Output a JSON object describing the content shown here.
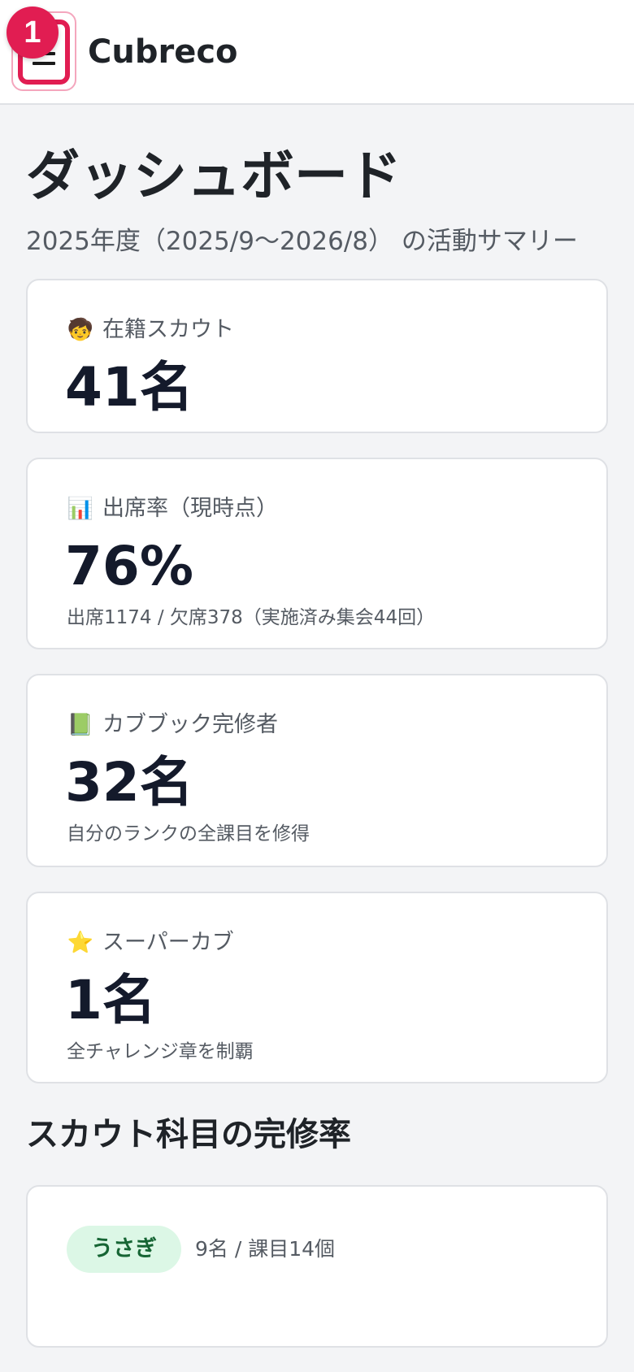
{
  "header": {
    "app_title": "Cubreco",
    "step_badge": "1",
    "menu_icon": "hamburger-menu-icon"
  },
  "page": {
    "title": "ダッシュボード",
    "subtitle": "2025年度（2025/9〜2026/8） の活動サマリー"
  },
  "stats": [
    {
      "icon": "person-icon",
      "emoji": "🧒",
      "label": "在籍スカウト",
      "value": "41名",
      "note": ""
    },
    {
      "icon": "bar-chart-icon",
      "emoji": "📊",
      "label": "出席率（現時点）",
      "value": "76%",
      "note": "出席1174 / 欠席378（実施済み集会44回）"
    },
    {
      "icon": "green-book-icon",
      "emoji": "📗",
      "label": "カブブック完修者",
      "value": "32名",
      "note": "自分のランクの全課目を修得"
    },
    {
      "icon": "star-icon",
      "emoji": "⭐",
      "label": "スーパーカブ",
      "value": "1名",
      "note": "全チャレンジ章を制覇"
    }
  ],
  "completion_section": {
    "title": "スカウト科目の完修率",
    "ranks": [
      {
        "name": "うさぎ",
        "meta": "9名 / 課目14個",
        "pill_bg": "#dcf7e6",
        "pill_fg": "#166534"
      }
    ]
  },
  "colors": {
    "accent": "#e11d52",
    "background": "#f3f4f6",
    "card": "#ffffff"
  }
}
